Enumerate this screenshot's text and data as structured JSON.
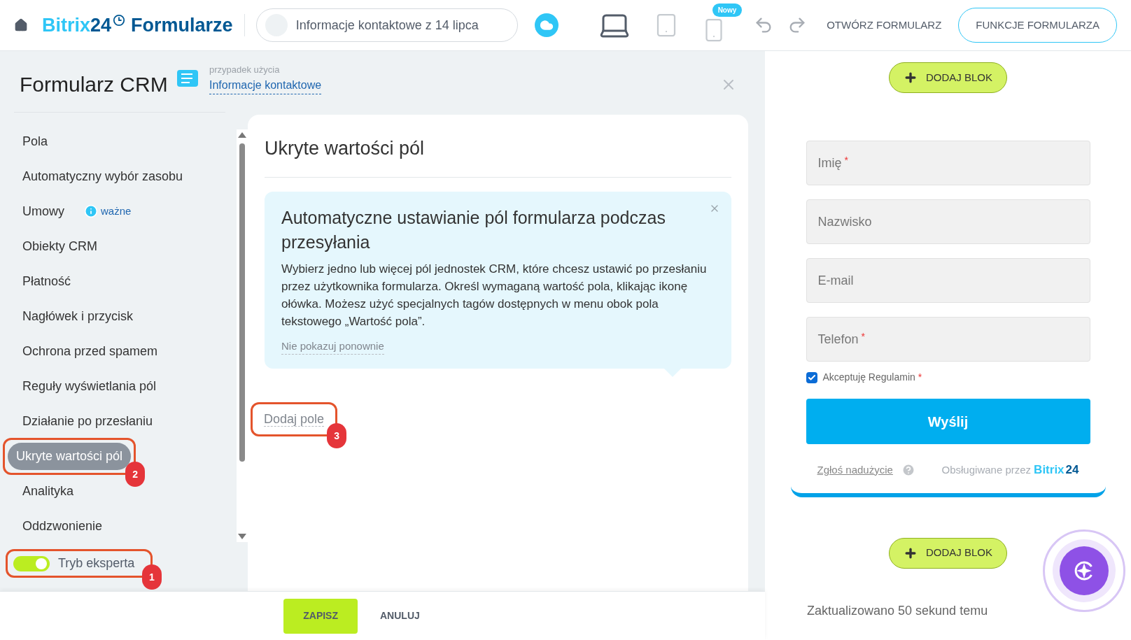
{
  "header": {
    "brand": "Bitrix24",
    "product": "Formularze",
    "form_name": "Informacje kontaktowe z 14 lipca",
    "devices": [
      {
        "kind": "desktop",
        "selected": true
      },
      {
        "kind": "tablet",
        "selected": false
      },
      {
        "kind": "mobile",
        "selected": false,
        "badge": "Nowy"
      }
    ],
    "open_form": "OTWÓRZ FORMULARZ",
    "form_features": "FUNKCJE FORMULARZA"
  },
  "panel": {
    "title": "Formularz CRM",
    "use_case_label": "przypadek użycia",
    "use_case_link": "Informacje kontaktowe",
    "menu": [
      {
        "label": "Pola",
        "selected": false
      },
      {
        "label": "Automatyczny wybór zasobu",
        "selected": false
      },
      {
        "label": "Umowy",
        "selected": false,
        "badge": "ważne"
      },
      {
        "label": "Obiekty CRM",
        "selected": false
      },
      {
        "label": "Płatność",
        "selected": false
      },
      {
        "label": "Nagłówek i przycisk",
        "selected": false
      },
      {
        "label": "Ochrona przed spamem",
        "selected": false
      },
      {
        "label": "Reguły wyświetlania pól",
        "selected": false
      },
      {
        "label": "Działanie po przesłaniu",
        "selected": false
      },
      {
        "label": "Ukryte wartości pól",
        "selected": true,
        "callout": "2"
      },
      {
        "label": "Analityka",
        "selected": false
      },
      {
        "label": "Oddzwonienie",
        "selected": false
      }
    ],
    "expert_mode": {
      "label": "Tryb eksperta",
      "on": true,
      "callout": "1"
    },
    "section": {
      "title": "Ukryte wartości pól",
      "hint": {
        "title": "Automatyczne ustawianie pól formularza podczas przesyłania",
        "body": "Wybierz jedno lub więcej pól jednostek CRM, które chcesz ustawić po przesłaniu przez użytkownika formularza. Określ wymaganą wartość pola, klikając ikonę ołówka. Możesz użyć specjalnych tagów dostępnych w menu obok pola tekstowego „Wartość pola”.",
        "dismiss": "Nie pokazuj ponownie"
      },
      "add_field": {
        "label": "Dodaj pole",
        "callout": "3"
      }
    },
    "buttons": [
      "ZAPISZ",
      "ANULUJ"
    ]
  },
  "preview": {
    "add_block": [
      "DODAJ BLOK",
      "DODAJ BLOK"
    ],
    "fields": [
      {
        "label": "Imię",
        "required": true
      },
      {
        "label": "Nazwisko",
        "required": false
      },
      {
        "label": "E-mail",
        "required": false
      },
      {
        "label": "Telefon",
        "required": true
      }
    ],
    "consent": {
      "label": "Akceptuję Regulamin",
      "checked": true,
      "required": true
    },
    "required_mark": "*",
    "submit": "Wyślij",
    "abuse": "Zgłoś nadużycie",
    "powered_by": "Obsługiwane przez",
    "powered_brand": "Bitrix",
    "powered_brand_number": "24",
    "updated": "Zaktualizowano 50 sekund temu"
  }
}
